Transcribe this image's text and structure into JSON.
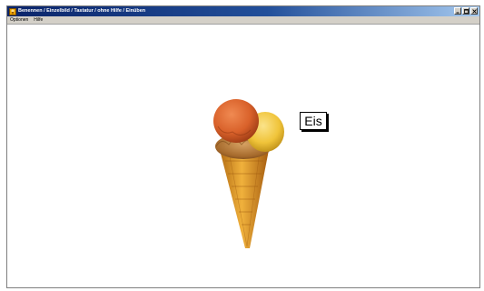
{
  "window": {
    "title": "Benennen / Einzelbild / Tastatur / ohne Hilfe / Einüben",
    "icons": {
      "app": "app-icon",
      "minimize": "minimize-icon",
      "maximize": "maximize-icon",
      "close": "close-icon"
    }
  },
  "menu": {
    "items": [
      {
        "label": "Optionen"
      },
      {
        "label": "Hilfe"
      }
    ]
  },
  "content": {
    "image": "ice-cream-cone",
    "word": "Eis"
  },
  "colors": {
    "titlebar_start": "#0a246a",
    "titlebar_end": "#a6caf0",
    "chrome": "#d4d0c8",
    "scoop_orange": "#d9612a",
    "scoop_yellow": "#f0c43a",
    "cone": "#d9962a"
  }
}
